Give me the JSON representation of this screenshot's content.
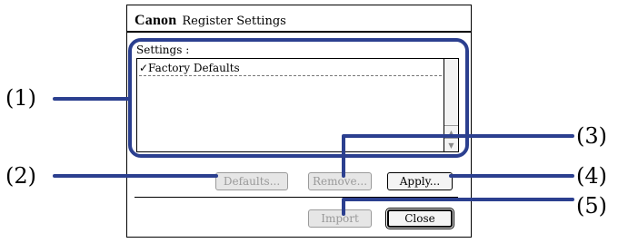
{
  "dialog": {
    "brand": "Canon",
    "title": "Register Settings"
  },
  "settings": {
    "label": "Settings :",
    "items": [
      "✓Factory Defaults"
    ]
  },
  "buttons": {
    "defaults": "Defaults...",
    "remove": "Remove...",
    "apply": "Apply...",
    "import": "Import",
    "close": "Close"
  },
  "callouts": {
    "c1": "(1)",
    "c2": "(2)",
    "c3": "(3)",
    "c4": "(4)",
    "c5": "(5)"
  },
  "colors": {
    "annotation": "#2b3f8f",
    "disabled_text": "#9a9a9a"
  },
  "icons": {
    "scroll_up": "triangle-up",
    "scroll_down": "triangle-down"
  }
}
